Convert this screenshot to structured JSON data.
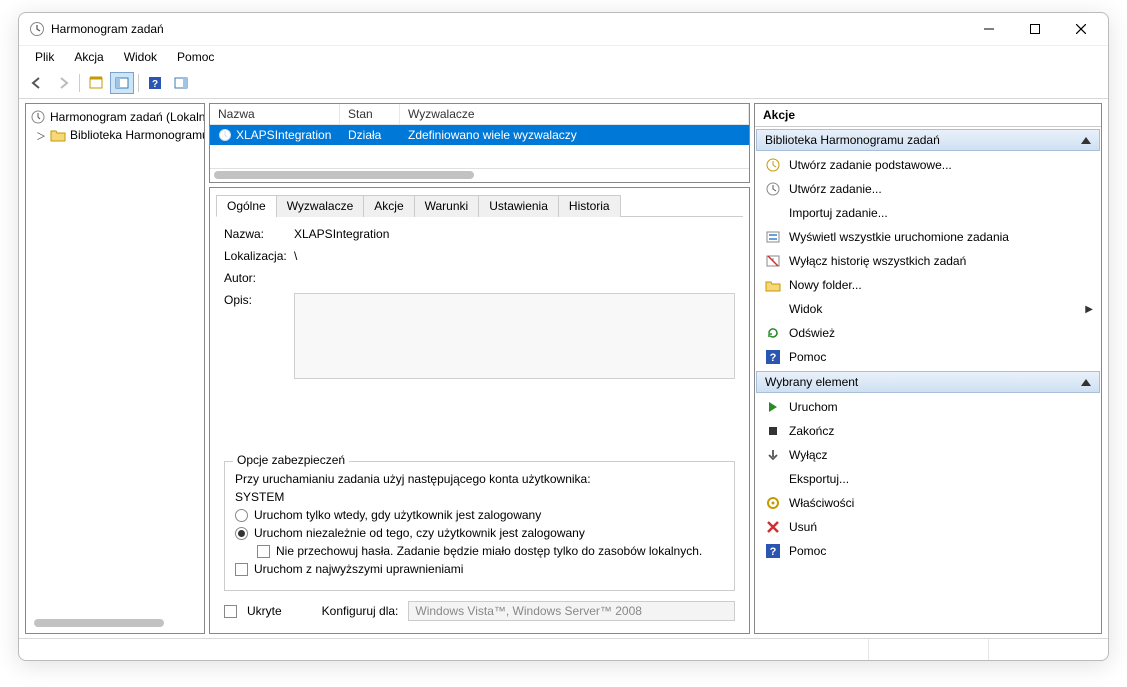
{
  "window": {
    "title": "Harmonogram zadań"
  },
  "menubar": [
    "Plik",
    "Akcja",
    "Widok",
    "Pomoc"
  ],
  "tree": {
    "root": "Harmonogram zadań (Lokalny)",
    "child": "Biblioteka Harmonogramu zadań"
  },
  "grid": {
    "headers": {
      "name": "Nazwa",
      "status": "Stan",
      "triggers": "Wyzwalacze"
    },
    "row": {
      "name": "XLAPSIntegration",
      "status": "Działa",
      "triggers": "Zdefiniowano wiele wyzwalaczy"
    }
  },
  "tabs": [
    "Ogólne",
    "Wyzwalacze",
    "Akcje",
    "Warunki",
    "Ustawienia",
    "Historia"
  ],
  "details": {
    "name_label": "Nazwa:",
    "name_value": "XLAPSIntegration",
    "location_label": "Lokalizacja:",
    "location_value": "\\",
    "author_label": "Autor:",
    "desc_label": "Opis:"
  },
  "security": {
    "legend": "Opcje zabezpieczeń",
    "line1": "Przy uruchamianiu zadania użyj następującego konta użytkownika:",
    "account": "SYSTEM",
    "radio_logged": "Uruchom tylko wtedy, gdy użytkownik jest zalogowany",
    "radio_always": "Uruchom niezależnie od tego, czy użytkownik jest zalogowany",
    "check_nopw": "Nie przechowuj hasła. Zadanie będzie miało dostęp tylko do zasobów lokalnych.",
    "check_highest": "Uruchom z najwyższymi uprawnieniami"
  },
  "bottom": {
    "hidden": "Ukryte",
    "config_for": "Konfiguruj dla:",
    "config_value": "Windows Vista™, Windows Server™ 2008"
  },
  "actions": {
    "title": "Akcje",
    "section1": "Biblioteka Harmonogramu zadań",
    "items1": [
      {
        "icon": "new-basic",
        "label": "Utwórz zadanie podstawowe..."
      },
      {
        "icon": "new-task",
        "label": "Utwórz zadanie..."
      },
      {
        "icon": "",
        "label": "Importuj zadanie..."
      },
      {
        "icon": "running",
        "label": "Wyświetl wszystkie uruchomione zadania"
      },
      {
        "icon": "disable-hist",
        "label": "Wyłącz historię wszystkich zadań"
      },
      {
        "icon": "folder",
        "label": "Nowy folder..."
      },
      {
        "icon": "",
        "label": "Widok",
        "arrow": true
      },
      {
        "icon": "refresh",
        "label": "Odśwież"
      },
      {
        "icon": "help",
        "label": "Pomoc"
      }
    ],
    "section2": "Wybrany element",
    "items2": [
      {
        "icon": "play",
        "label": "Uruchom"
      },
      {
        "icon": "stop",
        "label": "Zakończ"
      },
      {
        "icon": "down",
        "label": "Wyłącz"
      },
      {
        "icon": "",
        "label": "Eksportuj..."
      },
      {
        "icon": "props",
        "label": "Właściwości"
      },
      {
        "icon": "delete",
        "label": "Usuń"
      },
      {
        "icon": "help",
        "label": "Pomoc"
      }
    ]
  }
}
